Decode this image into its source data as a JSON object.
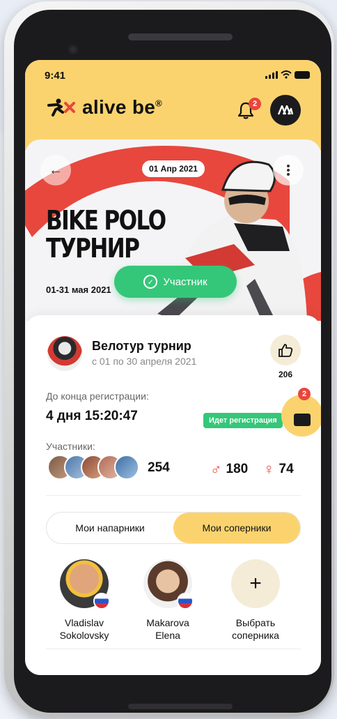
{
  "status_bar": {
    "time": "9:41"
  },
  "header": {
    "brand": "alive be",
    "brand_mark": "®",
    "notifications_count": "2",
    "avatar_initial": "M"
  },
  "hero": {
    "date": "01 Апр 2021",
    "title_line1": "BIKE POLO",
    "title_line2": "ТУРНИР",
    "dates": "01-31 мая 2021",
    "participant_button": "Участник"
  },
  "event": {
    "title": "Велотур турнир",
    "subtitle": "с 01 по 30 апреля 2021",
    "likes": "206",
    "registration_label": "До конца регистрации:",
    "registration_timer": "4 дня 15:20:47",
    "registration_status": "Идет регистрация",
    "participants_label": "Участники:",
    "participants_count": "254",
    "male_count": "180",
    "female_count": "74"
  },
  "tabs": {
    "teammates": "Мои напарники",
    "rivals": "Мои соперники"
  },
  "people": [
    {
      "name_line1": "Vladislav",
      "name_line2": "Sokolovsky"
    },
    {
      "name_line1": "Makarova",
      "name_line2": "Elena"
    }
  ],
  "add_rival": {
    "line1": "Выбрать",
    "line2": "соперника"
  },
  "fab": {
    "badge": "2"
  },
  "colors": {
    "brand_yellow": "#fbd36e",
    "accent_green": "#34c779",
    "accent_red": "#e8473d"
  }
}
